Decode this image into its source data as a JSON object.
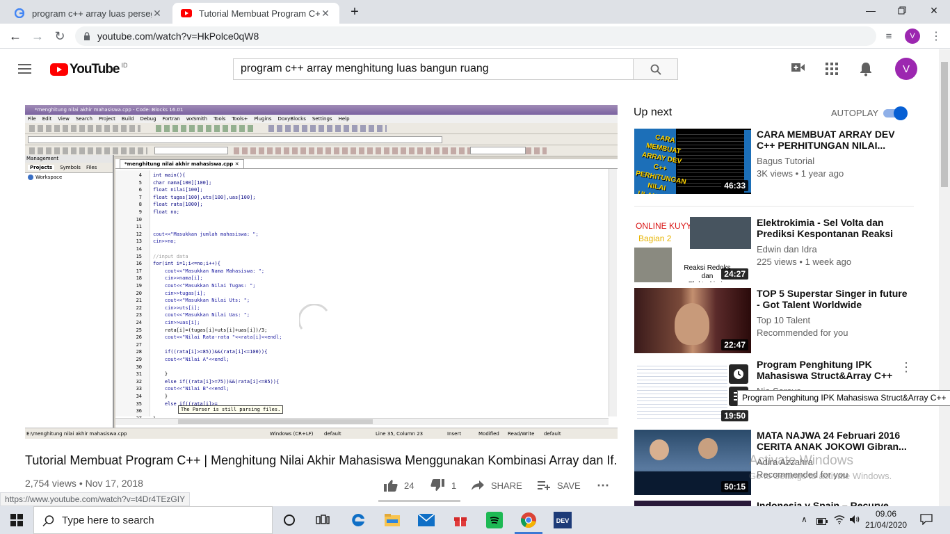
{
  "browser": {
    "tabs": [
      {
        "title": "program c++ array luas persegi p",
        "icon": "google-icon"
      },
      {
        "title": "Tutorial Membuat Program C++ ",
        "icon": "youtube-icon"
      }
    ],
    "url": "youtube.com/watch?v=HkPolce0qW8",
    "profile_initial": "V"
  },
  "youtube": {
    "logo_text": "YouTube",
    "logo_region": "ID",
    "search_value": "program c++ array menghitung luas bangun ruang",
    "avatar_initial": "V"
  },
  "player": {
    "window_title": "*menghitung nilai akhir mahasiswa.cpp - Code::Blocks 16.01",
    "menu": [
      "File",
      "Edit",
      "View",
      "Search",
      "Project",
      "Build",
      "Debug",
      "Fortran",
      "wxSmith",
      "Tools",
      "Tools+",
      "Plugins",
      "DoxyBlocks",
      "Settings",
      "Help"
    ],
    "management_title": "Management",
    "management_tabs": [
      "Projects",
      "Symbols",
      "Files"
    ],
    "workspace": "Workspace",
    "editor_tab": "*menghitung nilai akhir mahasiswa.cpp",
    "code_lines": [
      {
        "n": "4",
        "t": "int main(){"
      },
      {
        "n": "5",
        "t": "char nama[100][100];"
      },
      {
        "n": "6",
        "t": "float nilai[100];"
      },
      {
        "n": "7",
        "t": "float tugas[100],uts[100],uas[100];"
      },
      {
        "n": "8",
        "t": "float rata[1000];"
      },
      {
        "n": "9",
        "t": "float no;"
      },
      {
        "n": "10",
        "t": ""
      },
      {
        "n": "11",
        "t": ""
      },
      {
        "n": "12",
        "t": "cout<<\"Masukkan jumlah mahasiswa: \";"
      },
      {
        "n": "13",
        "t": "cin>>no;"
      },
      {
        "n": "14",
        "t": ""
      },
      {
        "n": "15",
        "t": "//input data"
      },
      {
        "n": "16",
        "t": "for(int i=1;i<=no;i++){"
      },
      {
        "n": "17",
        "t": "    cout<<\"Masukkan Nama Mahasiswa: \";"
      },
      {
        "n": "18",
        "t": "    cin>>nama[i];"
      },
      {
        "n": "19",
        "t": "    cout<<\"Masukkan Nilai Tugas: \";"
      },
      {
        "n": "20",
        "t": "    cin>>tugas[i];"
      },
      {
        "n": "21",
        "t": "    cout<<\"Masukkan Nilai Uts: \";"
      },
      {
        "n": "22",
        "t": "    cin>>uts[i];"
      },
      {
        "n": "23",
        "t": "    cout<<\"Masukkan Nilai Uas: \";"
      },
      {
        "n": "24",
        "t": "    cin>>uas[i];"
      },
      {
        "n": "25",
        "t": "    rata[i]=(tugas[i]+uts[i]+uas[i])/3;"
      },
      {
        "n": "26",
        "t": "    cout<<\"Nilai Rata-rata \"<<rata[i]<<endl;"
      },
      {
        "n": "27",
        "t": ""
      },
      {
        "n": "28",
        "t": "    if((rata[i]>=85))&&(rata[i]<=100)){"
      },
      {
        "n": "29",
        "t": "    cout<<\"Nilai A\"<<endl;"
      },
      {
        "n": "30",
        "t": ""
      },
      {
        "n": "31",
        "t": "    }"
      },
      {
        "n": "32",
        "t": "    else if((rata[i]>=75))&&(rata[i]<=85)){"
      },
      {
        "n": "33",
        "t": "    cout<<\"Nilai B\"<<endl;"
      },
      {
        "n": "34",
        "t": "    }"
      },
      {
        "n": "35",
        "t": "    else if((rata[i]>="
      },
      {
        "n": "36",
        "t": ""
      },
      {
        "n": "37",
        "t": "}"
      }
    ],
    "tooltip": "The Parser is still parsing files.",
    "status_file": "E:\\menghitung nilai akhir mahasiswa.cpp",
    "status_eol": "Windows (CR+LF)",
    "status_default": "default",
    "status_pos": "Line 35, Column 23",
    "status_insert": "Insert",
    "status_modified": "Modified",
    "status_rw": "Read/Write",
    "status_default2": "default"
  },
  "video": {
    "title": "Tutorial Membuat Program C++ | Menghitung Nilai Akhir Mahasiswa Menggunakan Kombinasi Array dan If.",
    "views": "2,754 views",
    "date": "Nov 17, 2018",
    "likes": "24",
    "dislikes": "1",
    "share": "SHARE",
    "save": "SAVE"
  },
  "sidebar": {
    "up_next": "Up next",
    "autoplay": "AUTOPLAY",
    "videos": [
      {
        "title": "CARA MEMBUAT ARRAY DEV C++ PERHITUNGAN NILAI...",
        "channel": "Bagus Tutorial",
        "meta": "3K views • 1 year ago",
        "duration": "46:33"
      },
      {
        "title": "Elektrokimia - Sel Volta dan Prediksi Kespontanan Reaksi",
        "channel": "Edwin dan Idra",
        "meta": "225 views • 1 week ago",
        "duration": "24:27"
      },
      {
        "title": "TOP 5 Superstar Singer in future - Got Talent Worldwide",
        "channel": "Top 10 Talent",
        "meta": "Recommended for you",
        "duration": "22:47"
      },
      {
        "title": "Program Penghitung IPK Mahasiswa Struct&Array C++",
        "channel": "Nia Saraya",
        "meta": "",
        "duration": "19:50"
      },
      {
        "title": "MATA NAJWA 24 Februari 2016 CERITA ANAK JOKOWI Gibran...",
        "channel": "Adira Azzahra",
        "meta": "Recommended for you",
        "duration": "50:15"
      },
      {
        "title": "Indonesia v Spain – Recurve",
        "channel": "",
        "meta": "",
        "duration": ""
      }
    ],
    "thumb1_text": "CARA MEMBUAT ARRAY DEV C++ PERHITUNGAN NILAI ULANGAN",
    "thumb2_text": "ONLINE KUYY",
    "thumb2_sub": "Bagian 2",
    "thumb2_caption": "Reaksi Redoks dan Elektrokimia",
    "tooltip": "Program Penghitung IPK Mahasiswa Struct&Array C++"
  },
  "watermark": {
    "line1": "Activate Windows",
    "line2": "Go to Settings to activate Windows."
  },
  "status_url": "https://www.youtube.com/watch?v=t4Dr4TEzGIY",
  "taskbar": {
    "search_placeholder": "Type here to search",
    "time": "09.06",
    "date": "21/04/2020"
  },
  "colors": {
    "youtube_red": "#ff0000",
    "avatar_purple": "#9c27b0",
    "toggle_blue": "#065fd4",
    "taskbar": "#dfe3ea"
  }
}
